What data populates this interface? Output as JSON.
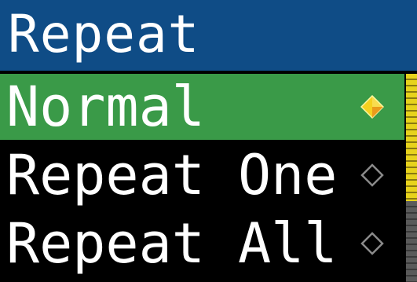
{
  "header": {
    "title": "Repeat"
  },
  "menu": {
    "items": [
      {
        "label": "Normal",
        "selected": true,
        "icon": "filled-diamond-icon"
      },
      {
        "label": "Repeat One",
        "selected": false,
        "icon": "outline-diamond-icon"
      },
      {
        "label": "Repeat All",
        "selected": false,
        "icon": "outline-diamond-icon"
      }
    ]
  },
  "colors": {
    "header_bg": "#0f4c86",
    "selected_bg": "#3a9a48",
    "background": "#000000",
    "text": "#ffffff",
    "selected_icon": "#f5d020",
    "scroll_thumb": "#e7d21c",
    "scroll_track": "#5a5a5a"
  }
}
